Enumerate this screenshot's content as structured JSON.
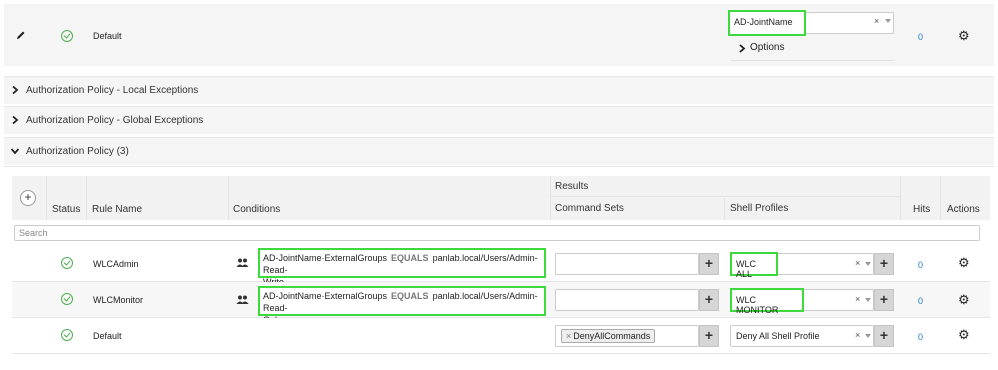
{
  "top_policy": {
    "rule_name": "Default",
    "condition_select_value": "AD-JointName",
    "options_label": "Options",
    "hits": "0"
  },
  "sections": [
    {
      "label": "Authorization Policy - Local Exceptions"
    },
    {
      "label": "Authorization Policy - Global Exceptions"
    },
    {
      "label": "Authorization Policy (3)"
    }
  ],
  "table": {
    "headers": {
      "status": "Status",
      "rule_name": "Rule Name",
      "conditions": "Conditions",
      "results": "Results",
      "command_sets": "Command Sets",
      "shell_profiles": "Shell Profiles",
      "hits": "Hits",
      "actions": "Actions"
    },
    "search_placeholder": "Search",
    "rows": [
      {
        "rule_name": "WLCAdmin",
        "cond_attr": "AD-JointName·ExternalGroups",
        "cond_op": "EQUALS",
        "cond_val_line1": "panlab.local/Users/Admin-Read-",
        "cond_val_line2": "Write",
        "command_set": "",
        "shell_profile": "WLC ALL",
        "hits": "0"
      },
      {
        "rule_name": "WLCMonitor",
        "cond_attr": "AD-JointName·ExternalGroups",
        "cond_op": "EQUALS",
        "cond_val_line1": "panlab.local/Users/Admin-Read-",
        "cond_val_line2": "Only",
        "command_set": "",
        "shell_profile": "WLC MONITOR",
        "hits": "0"
      },
      {
        "rule_name": "Default",
        "command_set": "DenyAllCommands",
        "shell_profile": "Deny All Shell Profile",
        "hits": "0"
      }
    ]
  },
  "icons": {
    "edit": "pencil-icon",
    "status": "check-circle-icon",
    "group": "users-icon",
    "settings": "gear-icon",
    "expand": "chevron-right-icon",
    "collapse": "chevron-down-icon",
    "add": "plus-icon",
    "clear": "x-icon",
    "dropdown": "caret-down-icon"
  },
  "colors": {
    "highlight": "#3dda3d",
    "status_green": "#4caf50",
    "link_blue": "#1f7bc9"
  }
}
